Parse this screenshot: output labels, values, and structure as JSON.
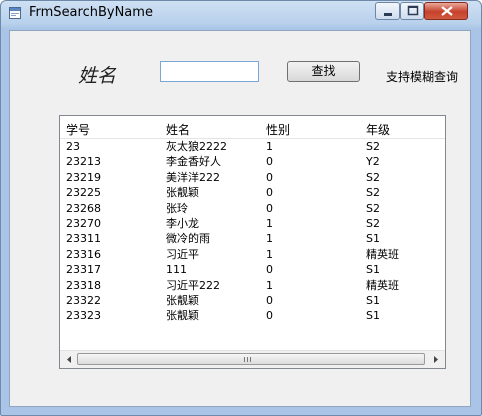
{
  "window": {
    "title": "FrmSearchByName"
  },
  "form": {
    "name_label": "姓名",
    "name_value": "",
    "search_label": "查找",
    "hint": "支持模糊查询"
  },
  "table": {
    "columns": [
      "学号",
      "姓名",
      "性别",
      "年级"
    ],
    "rows": [
      [
        "23",
        "灰太狼2222",
        "1",
        "S2"
      ],
      [
        "23213",
        "李金香好人",
        "0",
        "Y2"
      ],
      [
        "23219",
        "美洋洋222",
        "0",
        "S2"
      ],
      [
        "23225",
        "张靓颖",
        "0",
        "S2"
      ],
      [
        "23268",
        "张玲",
        "0",
        "S2"
      ],
      [
        "23270",
        "李小龙",
        "1",
        "S2"
      ],
      [
        "23311",
        "微冷的雨",
        "1",
        "S1"
      ],
      [
        "23316",
        "习近平",
        "1",
        "精英班"
      ],
      [
        "23317",
        "111",
        "0",
        "S1"
      ],
      [
        "23318",
        "习近平222",
        "1",
        "精英班"
      ],
      [
        "23322",
        "张靓颖",
        "0",
        "S1"
      ],
      [
        "23323",
        "张靓颖",
        "0",
        "S1"
      ]
    ]
  },
  "icons": {
    "app": "form-icon",
    "minimize": "minimize-icon",
    "maximize": "maximize-icon",
    "close": "close-icon",
    "scroll_left": "arrow-left-icon",
    "scroll_right": "arrow-right-icon"
  },
  "colors": {
    "close_button": "#c6412b",
    "input_border": "#7aa7d6"
  }
}
